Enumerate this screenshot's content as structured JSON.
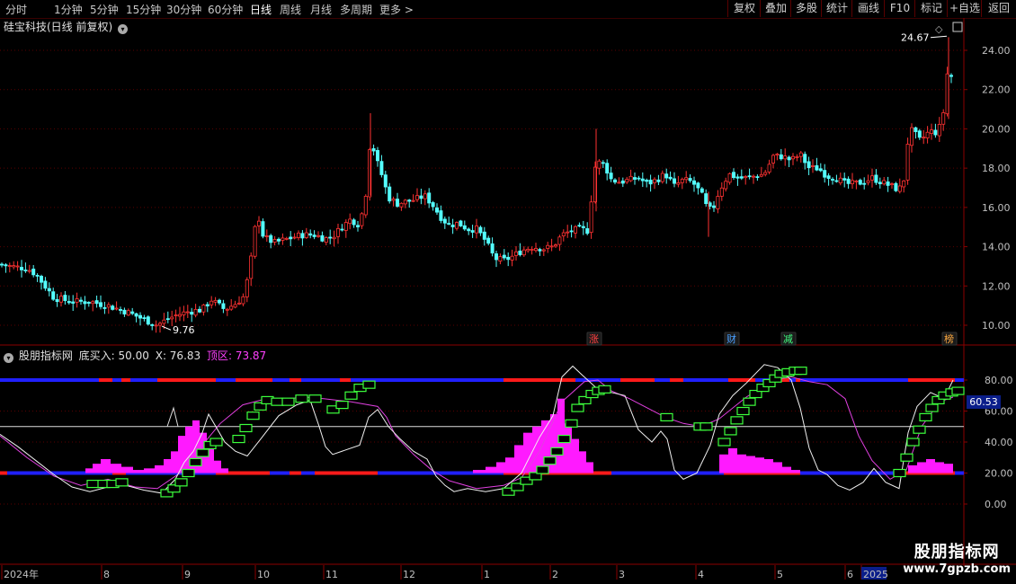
{
  "toolbar": {
    "timeframes": [
      "分时",
      "1分钟",
      "5分钟",
      "15分钟",
      "30分钟",
      "60分钟",
      "日线",
      "周线",
      "月线",
      "多周期",
      "更多 >"
    ],
    "active": "日线",
    "buttons": [
      "复权",
      "叠加",
      "多股",
      "统计",
      "画线",
      "F10",
      "标记",
      "+自选",
      "返回"
    ]
  },
  "stock": {
    "title": "硅宝科技(日线 前复权)"
  },
  "indicator": {
    "name": "股朋指标网",
    "buy_label": "底买入: 50.00",
    "x_label": "X: 76.83",
    "top_label": "顶区: 73.87",
    "current_value": "60.53"
  },
  "watermark": {
    "name": "股朋指标网",
    "url": "www.7gpzb.com"
  },
  "chart_data": {
    "type": "candlestick",
    "price_axis": {
      "ticks": [
        "24.00",
        "22.00",
        "20.00",
        "18.00",
        "16.00",
        "14.00",
        "12.00",
        "10.00"
      ],
      "range": [
        9.3,
        25.6
      ]
    },
    "indicator_axis": {
      "ticks": [
        "80.00",
        "60.00",
        "40.00",
        "20.00",
        "0.00"
      ],
      "range": [
        -10,
        100
      ]
    },
    "x_labels": [
      "2024年",
      "8",
      "9",
      "10",
      "11",
      "12",
      "1",
      "2",
      "3",
      "4",
      "5",
      "6",
      "2025"
    ],
    "annotations": {
      "high": "24.67",
      "low": "9.76"
    },
    "event_markers": [
      "涨",
      "财",
      "减",
      "榜"
    ],
    "levels": {
      "buy_line": 50,
      "top_band": 80,
      "bottom_band": 20
    },
    "anchors": [
      [
        0,
        13.1
      ],
      [
        12,
        13.0
      ],
      [
        30,
        12.9
      ],
      [
        40,
        12.6
      ],
      [
        60,
        11.4
      ],
      [
        80,
        11.2
      ],
      [
        100,
        11.2
      ],
      [
        120,
        11.0
      ],
      [
        140,
        10.7
      ],
      [
        155,
        10.4
      ],
      [
        165,
        10.2
      ],
      [
        175,
        10.0
      ],
      [
        182,
        10.2
      ],
      [
        195,
        10.5
      ],
      [
        210,
        10.7
      ],
      [
        225,
        10.8
      ],
      [
        235,
        11.3
      ],
      [
        250,
        10.8
      ],
      [
        262,
        11.1
      ],
      [
        272,
        11.5
      ],
      [
        280,
        13.6
      ],
      [
        286,
        15.8
      ],
      [
        293,
        14.5
      ],
      [
        305,
        14.2
      ],
      [
        320,
        14.4
      ],
      [
        335,
        14.6
      ],
      [
        350,
        14.6
      ],
      [
        362,
        14.4
      ],
      [
        372,
        14.6
      ],
      [
        380,
        15.0
      ],
      [
        390,
        15.4
      ],
      [
        400,
        15.1
      ],
      [
        408,
        17.0
      ],
      [
        412,
        19.6
      ],
      [
        418,
        18.5
      ],
      [
        425,
        17.6
      ],
      [
        432,
        16.5
      ],
      [
        442,
        16.2
      ],
      [
        452,
        16.3
      ],
      [
        462,
        16.4
      ],
      [
        472,
        16.6
      ],
      [
        480,
        16.2
      ],
      [
        492,
        15.4
      ],
      [
        500,
        15.1
      ],
      [
        510,
        15.2
      ],
      [
        520,
        14.9
      ],
      [
        530,
        14.9
      ],
      [
        540,
        14.3
      ],
      [
        550,
        13.4
      ],
      [
        560,
        13.3
      ],
      [
        570,
        13.5
      ],
      [
        580,
        13.8
      ],
      [
        592,
        14.0
      ],
      [
        605,
        13.9
      ],
      [
        615,
        14.0
      ],
      [
        625,
        14.6
      ],
      [
        635,
        14.8
      ],
      [
        645,
        14.9
      ],
      [
        655,
        14.8
      ],
      [
        660,
        17.9
      ],
      [
        665,
        18.3
      ],
      [
        672,
        18.2
      ],
      [
        680,
        17.4
      ],
      [
        690,
        17.3
      ],
      [
        700,
        17.4
      ],
      [
        710,
        17.5
      ],
      [
        720,
        17.2
      ],
      [
        730,
        17.4
      ],
      [
        740,
        17.7
      ],
      [
        750,
        17.1
      ],
      [
        760,
        17.4
      ],
      [
        770,
        17.3
      ],
      [
        780,
        16.7
      ],
      [
        785,
        16.1
      ],
      [
        792,
        15.8
      ],
      [
        798,
        16.6
      ],
      [
        805,
        17.3
      ],
      [
        812,
        17.7
      ],
      [
        820,
        17.5
      ],
      [
        830,
        17.5
      ],
      [
        840,
        17.6
      ],
      [
        850,
        17.7
      ],
      [
        860,
        18.6
      ],
      [
        870,
        18.6
      ],
      [
        880,
        18.4
      ],
      [
        890,
        18.7
      ],
      [
        900,
        18.0
      ],
      [
        910,
        18.0
      ],
      [
        920,
        17.6
      ],
      [
        930,
        17.5
      ],
      [
        940,
        17.2
      ],
      [
        950,
        17.2
      ],
      [
        960,
        17.3
      ],
      [
        970,
        17.5
      ],
      [
        980,
        17.3
      ],
      [
        990,
        17.1
      ],
      [
        1000,
        16.9
      ],
      [
        1006,
        17.5
      ],
      [
        1011,
        20.0
      ],
      [
        1017,
        19.8
      ],
      [
        1022,
        19.4
      ],
      [
        1028,
        19.6
      ],
      [
        1034,
        19.9
      ],
      [
        1040,
        19.8
      ],
      [
        1045,
        20.1
      ],
      [
        1050,
        21.0
      ],
      [
        1055,
        23.5
      ],
      [
        1059,
        22.4
      ]
    ],
    "white_line": [
      [
        0,
        45
      ],
      [
        20,
        37
      ],
      [
        40,
        28
      ],
      [
        60,
        19
      ],
      [
        80,
        11
      ],
      [
        100,
        8
      ],
      [
        120,
        11
      ],
      [
        140,
        12
      ],
      [
        160,
        9
      ],
      [
        180,
        7
      ],
      [
        195,
        16
      ],
      [
        205,
        27
      ],
      [
        215,
        34
      ],
      [
        225,
        46
      ],
      [
        232,
        58
      ],
      [
        240,
        50
      ],
      [
        250,
        40
      ],
      [
        262,
        34
      ],
      [
        275,
        31
      ],
      [
        290,
        42
      ],
      [
        310,
        57
      ],
      [
        330,
        64
      ],
      [
        345,
        67
      ],
      [
        355,
        50
      ],
      [
        362,
        37
      ],
      [
        370,
        32
      ],
      [
        380,
        34
      ],
      [
        400,
        38
      ],
      [
        410,
        56
      ],
      [
        420,
        61
      ],
      [
        432,
        50
      ],
      [
        445,
        42
      ],
      [
        460,
        34
      ],
      [
        475,
        29
      ],
      [
        485,
        18
      ],
      [
        495,
        12
      ],
      [
        505,
        8
      ],
      [
        520,
        10
      ],
      [
        540,
        8
      ],
      [
        560,
        10
      ],
      [
        580,
        20
      ],
      [
        600,
        43
      ],
      [
        615,
        57
      ],
      [
        625,
        82
      ],
      [
        637,
        89
      ],
      [
        648,
        83
      ],
      [
        665,
        74
      ],
      [
        680,
        72
      ],
      [
        695,
        70
      ],
      [
        710,
        48
      ],
      [
        725,
        40
      ],
      [
        735,
        47
      ],
      [
        742,
        42
      ],
      [
        750,
        22
      ],
      [
        760,
        16
      ],
      [
        775,
        20
      ],
      [
        790,
        38
      ],
      [
        800,
        58
      ],
      [
        815,
        70
      ],
      [
        830,
        78
      ],
      [
        850,
        90
      ],
      [
        865,
        88
      ],
      [
        880,
        80
      ],
      [
        890,
        62
      ],
      [
        900,
        36
      ],
      [
        910,
        22
      ],
      [
        920,
        19
      ],
      [
        932,
        12
      ],
      [
        945,
        9
      ],
      [
        960,
        14
      ],
      [
        972,
        23
      ],
      [
        985,
        14
      ],
      [
        1000,
        10
      ],
      [
        1010,
        46
      ],
      [
        1020,
        63
      ],
      [
        1035,
        72
      ],
      [
        1050,
        68
      ],
      [
        1060,
        80
      ]
    ],
    "magenta_line": [
      [
        0,
        44
      ],
      [
        30,
        30
      ],
      [
        60,
        18
      ],
      [
        90,
        12
      ],
      [
        120,
        16
      ],
      [
        150,
        11
      ],
      [
        175,
        10
      ],
      [
        200,
        20
      ],
      [
        225,
        38
      ],
      [
        245,
        52
      ],
      [
        270,
        64
      ],
      [
        290,
        67
      ],
      [
        320,
        68
      ],
      [
        340,
        69
      ],
      [
        360,
        68
      ],
      [
        390,
        66
      ],
      [
        420,
        63
      ],
      [
        430,
        56
      ],
      [
        440,
        44
      ],
      [
        460,
        32
      ],
      [
        480,
        22
      ],
      [
        500,
        15
      ],
      [
        530,
        10
      ],
      [
        560,
        12
      ],
      [
        580,
        17
      ],
      [
        600,
        34
      ],
      [
        625,
        66
      ],
      [
        650,
        79
      ],
      [
        665,
        80
      ],
      [
        680,
        73
      ],
      [
        700,
        68
      ],
      [
        720,
        62
      ],
      [
        740,
        56
      ],
      [
        760,
        52
      ],
      [
        780,
        50
      ],
      [
        800,
        55
      ],
      [
        830,
        69
      ],
      [
        860,
        80
      ],
      [
        880,
        82
      ],
      [
        900,
        79
      ],
      [
        920,
        77
      ],
      [
        940,
        68
      ],
      [
        955,
        44
      ],
      [
        970,
        28
      ],
      [
        990,
        16
      ],
      [
        1008,
        22
      ],
      [
        1025,
        50
      ],
      [
        1045,
        66
      ],
      [
        1060,
        69
      ]
    ],
    "histogram": [
      [
        95,
        103,
        3
      ],
      [
        103,
        112,
        6
      ],
      [
        112,
        123,
        9
      ],
      [
        123,
        135,
        6
      ],
      [
        135,
        148,
        4
      ],
      [
        148,
        160,
        2
      ],
      [
        160,
        172,
        3
      ],
      [
        172,
        182,
        5
      ],
      [
        182,
        190,
        9
      ],
      [
        190,
        198,
        14
      ],
      [
        198,
        206,
        24
      ],
      [
        206,
        214,
        30
      ],
      [
        214,
        222,
        34
      ],
      [
        222,
        230,
        26
      ],
      [
        230,
        238,
        16
      ],
      [
        238,
        246,
        8
      ],
      [
        246,
        254,
        3
      ],
      [
        526,
        540,
        2
      ],
      [
        540,
        552,
        4
      ],
      [
        552,
        562,
        7
      ],
      [
        562,
        572,
        10
      ],
      [
        572,
        582,
        18
      ],
      [
        582,
        592,
        26
      ],
      [
        592,
        602,
        30
      ],
      [
        602,
        612,
        34
      ],
      [
        612,
        620,
        38
      ],
      [
        620,
        628,
        48
      ],
      [
        628,
        636,
        32
      ],
      [
        636,
        644,
        22
      ],
      [
        644,
        652,
        14
      ],
      [
        652,
        660,
        7
      ],
      [
        800,
        810,
        12
      ],
      [
        810,
        820,
        16
      ],
      [
        820,
        830,
        12
      ],
      [
        830,
        840,
        11
      ],
      [
        840,
        850,
        10
      ],
      [
        850,
        860,
        9
      ],
      [
        860,
        870,
        7
      ],
      [
        870,
        880,
        4
      ],
      [
        880,
        890,
        2
      ],
      [
        1010,
        1020,
        5
      ],
      [
        1020,
        1030,
        7
      ],
      [
        1030,
        1040,
        9
      ],
      [
        1040,
        1050,
        7
      ],
      [
        1050,
        1060,
        6
      ]
    ],
    "boxes": [
      [
        103,
        13
      ],
      [
        115,
        13
      ],
      [
        125,
        13
      ],
      [
        135,
        14
      ],
      [
        185,
        7
      ],
      [
        193,
        10
      ],
      [
        201,
        14
      ],
      [
        209,
        20
      ],
      [
        217,
        27
      ],
      [
        225,
        33
      ],
      [
        233,
        38
      ],
      [
        240,
        40
      ],
      [
        265,
        42
      ],
      [
        273,
        49
      ],
      [
        281,
        57
      ],
      [
        289,
        63
      ],
      [
        297,
        67
      ],
      [
        308,
        66
      ],
      [
        320,
        66
      ],
      [
        335,
        68
      ],
      [
        350,
        68
      ],
      [
        370,
        61
      ],
      [
        380,
        64
      ],
      [
        390,
        70
      ],
      [
        400,
        75
      ],
      [
        410,
        77
      ],
      [
        565,
        8
      ],
      [
        575,
        11
      ],
      [
        585,
        15
      ],
      [
        595,
        18
      ],
      [
        603,
        22
      ],
      [
        611,
        28
      ],
      [
        619,
        34
      ],
      [
        627,
        42
      ],
      [
        635,
        52
      ],
      [
        642,
        62
      ],
      [
        650,
        67
      ],
      [
        658,
        71
      ],
      [
        665,
        73
      ],
      [
        672,
        74
      ],
      [
        741,
        56
      ],
      [
        778,
        50
      ],
      [
        785,
        50
      ],
      [
        805,
        40
      ],
      [
        812,
        47
      ],
      [
        819,
        54
      ],
      [
        826,
        60
      ],
      [
        833,
        66
      ],
      [
        840,
        71
      ],
      [
        848,
        75
      ],
      [
        855,
        78
      ],
      [
        862,
        81
      ],
      [
        868,
        84
      ],
      [
        876,
        85
      ],
      [
        884,
        86
      ],
      [
        890,
        86
      ],
      [
        1000,
        20
      ],
      [
        1008,
        30
      ],
      [
        1015,
        40
      ],
      [
        1022,
        48
      ],
      [
        1029,
        56
      ],
      [
        1036,
        62
      ],
      [
        1043,
        67
      ],
      [
        1050,
        70
      ],
      [
        1058,
        72
      ],
      [
        1065,
        73
      ]
    ]
  }
}
